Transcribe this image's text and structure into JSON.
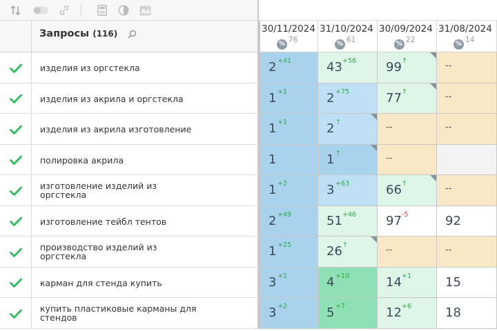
{
  "toolbar": {
    "icons": [
      "sort-icon",
      "toggle-icon",
      "link-icon",
      "calculator-icon",
      "contrast-icon",
      "font-icon"
    ]
  },
  "header": {
    "title": "Запросы",
    "count": "(116)",
    "dates": [
      {
        "date": "30/11/2024",
        "pct": "76"
      },
      {
        "date": "31/10/2024",
        "pct": "61"
      },
      {
        "date": "30/09/2024",
        "pct": "22"
      },
      {
        "date": "31/08/2024",
        "pct": "14"
      }
    ],
    "pct_symbol": "%"
  },
  "colors": {
    "blue_dark": "#a9d3ed",
    "blue_light": "#bfe0f4",
    "green_light": "#dff5e8",
    "green_mid": "#c6eed7",
    "green_strong": "#8fe0b4",
    "beige": "#f9e8c6",
    "gray": "#f3f3f3",
    "white": "#ffffff",
    "check": "#2bbf5c"
  },
  "rows": [
    {
      "query": "изделия из оргстекла",
      "cells": [
        {
          "value": "2",
          "delta": "+41",
          "dir": "up",
          "bg": "blue_dark"
        },
        {
          "value": "43",
          "delta": "+56",
          "dir": "up",
          "bg": "green_light"
        },
        {
          "value": "99",
          "delta": "↑",
          "dir": "up",
          "bg": "green_light",
          "corner": true
        },
        {
          "value": "--",
          "delta": "",
          "dir": "",
          "bg": "beige"
        }
      ]
    },
    {
      "query": "изделия из акрила и оргстекла",
      "cells": [
        {
          "value": "1",
          "delta": "+1",
          "dir": "up",
          "bg": "blue_dark"
        },
        {
          "value": "2",
          "delta": "+75",
          "dir": "up",
          "bg": "blue_light"
        },
        {
          "value": "77",
          "delta": "↑",
          "dir": "up",
          "bg": "green_light",
          "corner": true
        },
        {
          "value": "--",
          "delta": "",
          "dir": "",
          "bg": "beige"
        }
      ]
    },
    {
      "query": "изделия из акрила изготовление",
      "cells": [
        {
          "value": "1",
          "delta": "+1",
          "dir": "up",
          "bg": "blue_dark"
        },
        {
          "value": "2",
          "delta": "↑",
          "dir": "up",
          "bg": "blue_light",
          "corner": true
        },
        {
          "value": "--",
          "delta": "",
          "dir": "",
          "bg": "beige"
        },
        {
          "value": "--",
          "delta": "",
          "dir": "",
          "bg": "beige"
        }
      ]
    },
    {
      "query": "полировка акрила",
      "cells": [
        {
          "value": "1",
          "delta": "",
          "dir": "",
          "bg": "blue_dark"
        },
        {
          "value": "1",
          "delta": "↑",
          "dir": "up",
          "bg": "blue_dark",
          "corner": true
        },
        {
          "value": "--",
          "delta": "",
          "dir": "",
          "bg": "beige"
        },
        {
          "value": "",
          "delta": "",
          "dir": "",
          "bg": "gray"
        }
      ]
    },
    {
      "query": "изготовление изделий из оргстекла",
      "cells": [
        {
          "value": "1",
          "delta": "+2",
          "dir": "up",
          "bg": "blue_dark"
        },
        {
          "value": "3",
          "delta": "+63",
          "dir": "up",
          "bg": "blue_light"
        },
        {
          "value": "66",
          "delta": "↑",
          "dir": "up",
          "bg": "green_light",
          "corner": true
        },
        {
          "value": "--",
          "delta": "",
          "dir": "",
          "bg": "beige"
        }
      ]
    },
    {
      "query": "изготовление тейбл тентов",
      "cells": [
        {
          "value": "2",
          "delta": "+49",
          "dir": "up",
          "bg": "blue_dark"
        },
        {
          "value": "51",
          "delta": "+46",
          "dir": "up",
          "bg": "green_light"
        },
        {
          "value": "97",
          "delta": "-5",
          "dir": "down",
          "bg": "white"
        },
        {
          "value": "92",
          "delta": "",
          "dir": "",
          "bg": "white"
        }
      ]
    },
    {
      "query": "производство изделий из оргстекла",
      "cells": [
        {
          "value": "1",
          "delta": "+25",
          "dir": "up",
          "bg": "blue_dark"
        },
        {
          "value": "26",
          "delta": "↑",
          "dir": "up",
          "bg": "green_light",
          "corner": true
        },
        {
          "value": "--",
          "delta": "",
          "dir": "",
          "bg": "beige"
        },
        {
          "value": "--",
          "delta": "",
          "dir": "",
          "bg": "beige"
        }
      ]
    },
    {
      "query": "карман для стенда купить",
      "cells": [
        {
          "value": "3",
          "delta": "+1",
          "dir": "up",
          "bg": "blue_dark"
        },
        {
          "value": "4",
          "delta": "+10",
          "dir": "up",
          "bg": "green_strong"
        },
        {
          "value": "14",
          "delta": "+1",
          "dir": "up",
          "bg": "green_light"
        },
        {
          "value": "15",
          "delta": "",
          "dir": "",
          "bg": "white"
        }
      ]
    },
    {
      "query": "купить пластиковые карманы для стендов",
      "cells": [
        {
          "value": "3",
          "delta": "+2",
          "dir": "up",
          "bg": "blue_dark"
        },
        {
          "value": "5",
          "delta": "+7",
          "dir": "up",
          "bg": "green_strong"
        },
        {
          "value": "12",
          "delta": "+6",
          "dir": "up",
          "bg": "green_light"
        },
        {
          "value": "18",
          "delta": "",
          "dir": "",
          "bg": "white"
        }
      ]
    }
  ]
}
